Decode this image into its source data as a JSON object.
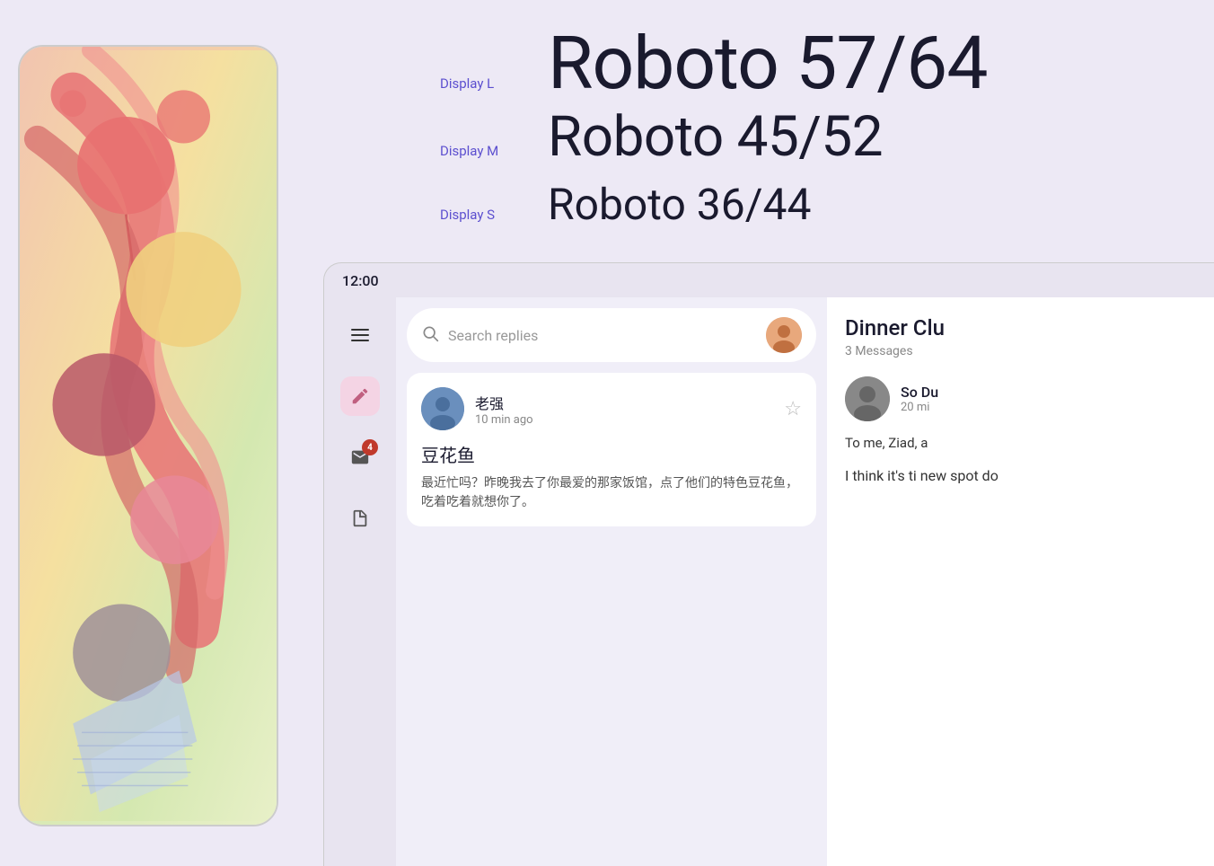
{
  "background_color": "#ede9f5",
  "left": {
    "phone": {
      "art_description": "Abstract 3D shapes with pink ribbons and colorful spheres on gradient background"
    }
  },
  "typography": {
    "display_l_label": "Display L",
    "display_l_text": "Roboto 57/64",
    "display_m_label": "Display M",
    "display_m_text": "Roboto 45/52",
    "display_s_label": "Display S",
    "display_s_text": "Roboto 36/44",
    "label_color": "#5c4fcf"
  },
  "app": {
    "status_time": "12:00",
    "search_placeholder": "Search replies",
    "sidebar_icons": [
      {
        "name": "menu",
        "symbol": "≡",
        "active": false,
        "badge": null
      },
      {
        "name": "compose",
        "symbol": "✏",
        "active": true,
        "badge": null
      },
      {
        "name": "inbox",
        "symbol": "📥",
        "active": false,
        "badge": "4"
      },
      {
        "name": "notes",
        "symbol": "📄",
        "active": false,
        "badge": null
      }
    ],
    "message": {
      "sender": "老强",
      "time_ago": "10 min ago",
      "subject": "豆花鱼",
      "preview": "最近忙吗？昨晚我去了你最爱的那家饭馆，点了他们的特色豆花鱼，吃着吃着就想你了。"
    },
    "detail": {
      "title": "Dinner Clu",
      "subtitle": "3 Messages",
      "contact_name": "So Du",
      "contact_time": "20 mi",
      "body_preview": "To me, Ziad, a",
      "body_text": "I think it's ti new spot do"
    }
  }
}
